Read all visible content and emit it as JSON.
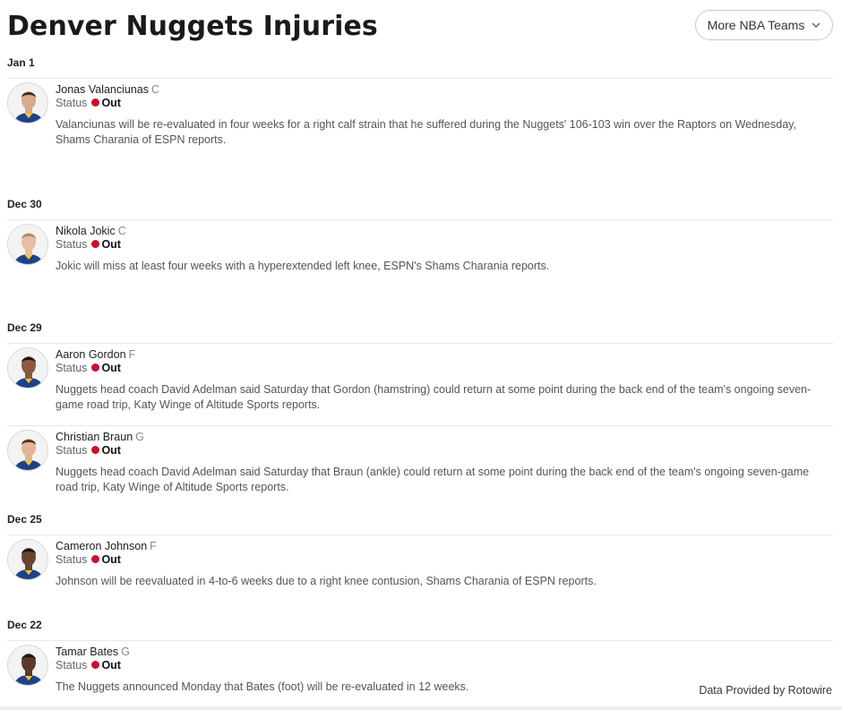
{
  "title": "Denver Nuggets Injuries",
  "more_teams_label": "More NBA Teams",
  "status_label": "Status",
  "footer": "Data Provided by Rotowire",
  "colors": {
    "out_dot": "#c8102e",
    "jersey": "#1d428a"
  },
  "groups": [
    {
      "date": "Jan 1",
      "entries": [
        {
          "name": "Jonas Valanciunas",
          "pos": "C",
          "status": "Out",
          "desc": "Valanciunas will be re-evaluated in four weeks for a right calf strain that he suffered during the Nuggets' 106-103 win over the Raptors on Wednesday, Shams Charania of ESPN reports."
        }
      ]
    },
    {
      "date": "Dec 30",
      "entries": [
        {
          "name": "Nikola Jokic",
          "pos": "C",
          "status": "Out",
          "desc": "Jokic will miss at least four weeks with a hyperextended left knee, ESPN's Shams Charania reports."
        }
      ]
    },
    {
      "date": "Dec 29",
      "entries": [
        {
          "name": "Aaron Gordon",
          "pos": "F",
          "status": "Out",
          "desc": "Nuggets head coach David Adelman said Saturday that Gordon (hamstring) could return at some point during the back end of the team's ongoing seven-game road trip, Katy Winge of Altitude Sports reports."
        },
        {
          "name": "Christian Braun",
          "pos": "G",
          "status": "Out",
          "desc": "Nuggets head coach David Adelman said Saturday that Braun (ankle) could return at some point during the back end of the team's ongoing seven-game road trip, Katy Winge of Altitude Sports reports."
        }
      ]
    },
    {
      "date": "Dec 25",
      "entries": [
        {
          "name": "Cameron Johnson",
          "pos": "F",
          "status": "Out",
          "desc": "Johnson will be reevaluated in 4-to-6 weeks due to a right knee contusion, Shams Charania of ESPN reports."
        }
      ]
    },
    {
      "date": "Dec 22",
      "entries": [
        {
          "name": "Tamar Bates",
          "pos": "G",
          "status": "Out",
          "desc": "The Nuggets announced Monday that Bates (foot) will be re-evaluated in 12 weeks."
        }
      ]
    }
  ]
}
